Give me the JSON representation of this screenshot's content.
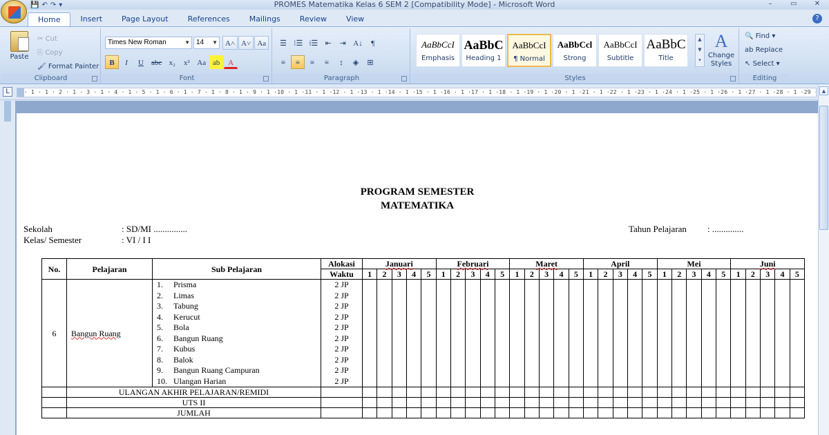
{
  "window": {
    "title": "PROMES Matematika Kelas 6 SEM 2 [Compatibility Mode] - Microsoft Word",
    "controls": [
      "–",
      "▭",
      "✕"
    ]
  },
  "quick_access": [
    "💾",
    "↶",
    "↷",
    "▾"
  ],
  "tabs": [
    "Home",
    "Insert",
    "Page Layout",
    "References",
    "Mailings",
    "Review",
    "View"
  ],
  "active_tab": "Home",
  "help_label": "?",
  "ribbon": {
    "clipboard": {
      "label": "Clipboard",
      "paste": "Paste",
      "cut": "Cut",
      "copy": "Copy",
      "format_painter": "Format Painter"
    },
    "font": {
      "label": "Font",
      "font_name": "Times New Roman",
      "font_size": "14",
      "grow": "A˄",
      "shrink": "A˅",
      "clear": "Aa",
      "bold": "B",
      "italic": "I",
      "underline": "U",
      "strike": "abc",
      "subscript": "x₂",
      "superscript": "x²",
      "change_case": "Aa",
      "highlight": "ab",
      "font_color": "A"
    },
    "paragraph": {
      "label": "Paragraph",
      "bullets": "☰",
      "numbering": "⁝☰",
      "multilevel": "⁞☰",
      "decrease_indent": "⇤",
      "increase_indent": "⇥",
      "sort": "A↓",
      "show_marks": "¶",
      "align_left": "≡",
      "align_center": "≡",
      "align_right": "≡",
      "justify": "≡",
      "line_spacing": "↕",
      "shading": "◈",
      "borders": "⊞"
    },
    "styles": {
      "label": "Styles",
      "items": [
        {
          "sample": "AaBbCcI",
          "name": "Emphasis"
        },
        {
          "sample": "AaBbC",
          "name": "Heading 1"
        },
        {
          "sample": "AaBbCcI",
          "name": "¶ Normal"
        },
        {
          "sample": "AaBbCcl",
          "name": "Strong"
        },
        {
          "sample": "AaBbCcI",
          "name": "Subtitle"
        },
        {
          "sample": "AaBbC",
          "name": "Title"
        }
      ],
      "change_styles": "Change Styles",
      "gallery_scroll": [
        "▲",
        "▼",
        "▾"
      ]
    },
    "editing": {
      "label": "Editing",
      "find": "Find",
      "replace": "Replace",
      "select": "Select"
    }
  },
  "ruler": {
    "corner": "L",
    "ticks": "· 1 · 1 · 2 · 1 · 3 · 1 · 4 · 1 · 5 · 1 · 6 · 1 · 7 · 1 · 8 · 1 · 9 · 1 ·10 · 1 ·11 · 1 ·12 · 1 ·13 · 1 ·14 · 1 ·15 · 1 ·16 · 1 ·17 · 1 ·18 · 1 ·19 · 1 ·20 · 1 ·21 · 1 ·22 · 1 ·23 · 1 ·24 · 1 ·25 · 1 ·26 · 1 ·27 · 1 ·28 · 1 ·29 · 1 ·30 · 1 ·31 · 1 ·32 ·"
  },
  "document": {
    "title_line1": "PROGRAM SEMESTER",
    "title_line2": "MATEMATIKA",
    "sekolah_label": "Sekolah",
    "sekolah_value": ": SD/MI ...............",
    "kelas_label": "Kelas/ Semester",
    "kelas_value": ": VI / I I",
    "tahun_label": "Tahun Pelajaran",
    "tahun_value": ": ..............",
    "table": {
      "headers": {
        "no": "No.",
        "pelajaran": "Pelajaran",
        "sub_pelajaran": "Sub Pelajaran",
        "alokasi": "Alokasi",
        "waktu": "Waktu"
      },
      "months": [
        "Januari",
        "Februari",
        "Maret",
        "April",
        "Mei",
        "Juni"
      ],
      "weeks": [
        "1",
        "2",
        "3",
        "4",
        "5"
      ],
      "row": {
        "no": "6",
        "pelajaran": "Bangun Ruang",
        "subs": [
          {
            "n": "1.",
            "t": "Prisma",
            "jp": "2 JP"
          },
          {
            "n": "2.",
            "t": "Limas",
            "jp": "2 JP"
          },
          {
            "n": "3.",
            "t": "Tabung",
            "jp": "2 JP"
          },
          {
            "n": "4.",
            "t": "Kerucut",
            "jp": "2 JP"
          },
          {
            "n": "5.",
            "t": "Bola",
            "jp": "2 JP"
          },
          {
            "n": "6.",
            "t": "Bangun Ruang",
            "jp": "2 JP"
          },
          {
            "n": "7.",
            "t": "Kubus",
            "jp": "2 JP"
          },
          {
            "n": "8.",
            "t": "Balok",
            "jp": "2 JP"
          },
          {
            "n": "9.",
            "t": "Bangun Ruang Campuran",
            "jp": "2 JP"
          },
          {
            "n": "10.",
            "t": "Ulangan Harian",
            "jp": "2 JP"
          }
        ]
      },
      "ulangan_akhir": "ULANGAN AKHIR PELAJARAN/REMIDI",
      "uts": "UTS  II",
      "jumlah": "JUMLAH"
    }
  }
}
